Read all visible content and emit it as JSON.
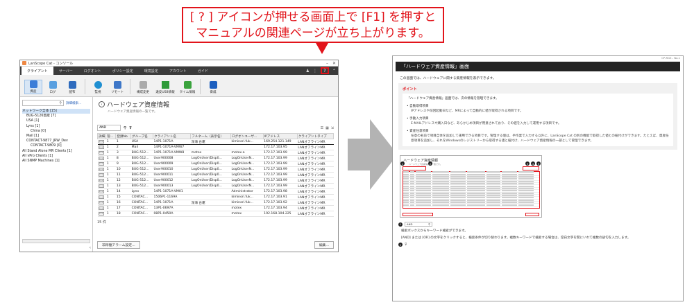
{
  "callout": {
    "line1": "[ ? ] アイコンが押せる画面上で [F1] を押すと",
    "line2": "マニュアルの関連ページが立ち上がります。"
  },
  "app": {
    "window_title": "LanScope Cat - コンソール",
    "menu": [
      "クライアント",
      "サーバー",
      "ログオント",
      "ポリシー設定",
      "環境設定",
      "アカウント",
      "ガイド"
    ],
    "toolbar": [
      "資産",
      "ログ",
      "配布",
      "監視",
      "リモート",
      "構成変更",
      "違反USB情報",
      "タイム情報",
      "脅威"
    ],
    "search_label": "詳細検索...",
    "tree": [
      {
        "label": "ネットワーク全体 [15]",
        "level": 0
      },
      {
        "label": "BUG-5126資産 [7]",
        "level": 1
      },
      {
        "label": "USA [1]",
        "level": 1
      },
      {
        "label": "Lynx [1]",
        "level": 1
      },
      {
        "label": "China [0]",
        "level": 2
      },
      {
        "label": "Mail [1]",
        "level": 1
      },
      {
        "label": "CONTACT-9877_JRW_Dev",
        "level": 1
      },
      {
        "label": "CONTACT-9809 [0]",
        "level": 2
      },
      {
        "label": "All Stand Alone MR Clients [1]",
        "level": 0
      },
      {
        "label": "All vPro Clients [1]",
        "level": 0
      },
      {
        "label": "All SNMP Machines [1]",
        "level": 0
      }
    ],
    "page_title": "ハードウェア資産情報",
    "page_subtitle": "ハードウェア資産情報の一覧です。",
    "search_mode": "AND",
    "columns": [
      "詳細",
      "管...",
      "登録No",
      "グループ名",
      "クライアント名",
      "フルネーム（表示名）",
      "ログオンユーザ...",
      "IPアドレス",
      "クライアントタイプ"
    ],
    "rows": [
      [
        "1",
        "1",
        "USA",
        "14P1-1071A",
        "深海 台運",
        "kiminori.fuk...",
        "169.254.121.149",
        "LANオフラインMR"
      ],
      [
        "1",
        "2",
        "Mail",
        "14P1-1071A-VMW7",
        "",
        "",
        "172.17.103.95",
        "LANオフラインMR"
      ],
      [
        "1",
        "3",
        "BUG-512...",
        "14P1-1071A-VMW8",
        "motex",
        "motex-a",
        "172.17.103.99",
        "LANオフラインMR"
      ],
      [
        "1",
        "8",
        "BUG-512...",
        "User900008",
        "LogOnUser/Disp0...",
        "LogOnUserN...",
        "172.17.103.99",
        "LANオフラインMR"
      ],
      [
        "1",
        "9",
        "BUG-512...",
        "User900009",
        "LogOnUser/Disp0...",
        "LogOnUserN...",
        "172.17.103.99",
        "LANオフラインMR"
      ],
      [
        "1",
        "10",
        "BUG-512...",
        "User900010",
        "LogOnUser/Disp0...",
        "LogOnUserN...",
        "172.17.103.99",
        "LANオフラインMR"
      ],
      [
        "1",
        "11",
        "BUG-512...",
        "User900011",
        "LogOnUser/Disp0...",
        "LogOnUserN...",
        "172.17.103.99",
        "LANオフラインMR"
      ],
      [
        "1",
        "12",
        "BUG-512...",
        "User900012",
        "LogOnUser/Disp0...",
        "LogOnUserN...",
        "172.17.103.99",
        "LANオフラインMR"
      ],
      [
        "1",
        "13",
        "BUG-512...",
        "User900013",
        "LogOnUser/Disp0...",
        "LogOnUserN...",
        "172.17.103.99",
        "LANオフラインMR"
      ],
      [
        "1",
        "14",
        "Lynx",
        "14P1-1071A-VM01",
        "",
        "Administrator",
        "172.17.103.98",
        "LANオフラインMR"
      ],
      [
        "1",
        "15",
        "CONTAC...",
        "1506P1-1169A",
        "",
        "kiminori.fuk...",
        "172.17.103.91",
        "LANオフラインMR"
      ],
      [
        "1",
        "16",
        "CONTAC...",
        "14P1-1071A",
        "深海 台運",
        "kiminori.fuk...",
        "172.17.103.92",
        "LANオフラインMR"
      ],
      [
        "1",
        "17",
        "CONTAC...",
        "13P1-0697A",
        "",
        "motex",
        "172.17.103.94",
        "LANオフラインMR"
      ],
      [
        "1",
        "18",
        "CONTAC...",
        "08P1-0450A",
        "",
        "motex",
        "192.168.104.225",
        "LANオフラインMR"
      ]
    ],
    "count": "15 件",
    "alarm_button": "非稼働アラーム設定...",
    "edit_button": "編集..."
  },
  "manual": {
    "page_id": "CP-RG5 - No.1",
    "heading": "「ハードウェア資産情報」画面",
    "intro": "この画面では、ハードウェアに関する資産情報を表示できます。",
    "point_title": "ポイント",
    "point_lead": "「ハードウェア資産情報」画面では、次の情報を管理できます。",
    "bullets": [
      {
        "title": "自動取得項目",
        "desc": "IPアドレスや前回起動日など、MRによって自動的に値が取得される項目です。"
      },
      {
        "title": "手動入力項目",
        "desc": "E-MAILアドレスや購入日など、あらかじめ項目が用意されており、その値を入力して運用する項目です。"
      },
      {
        "title": "資産任意項目",
        "desc": "任意の名前で項目自体を追加して運用できる項目です。管理する値は、手作業で入力する以外に、LanScope Cat の別の機能で取得した値との紐付けができます。たとえば、資産任意項目を追加し、それをWindowsのレジストリーから取得する値と紐付け、ハードウェア資産情報の一部として管理できます。"
      }
    ],
    "shot_title": "ハードウェア資産情報",
    "shot_subtitle": "ハードウェア資産情報の一覧です。",
    "section1_input": "AND",
    "section1_text1": "検索ボックスからキーワード検索ができます。",
    "section1_text2": "[AND] または [OR] の文字をクリックすると、検索条件が切り替わります。複数キーワードで検索する場合は、空白文字を間にいれて複数の語句を入力します。"
  }
}
